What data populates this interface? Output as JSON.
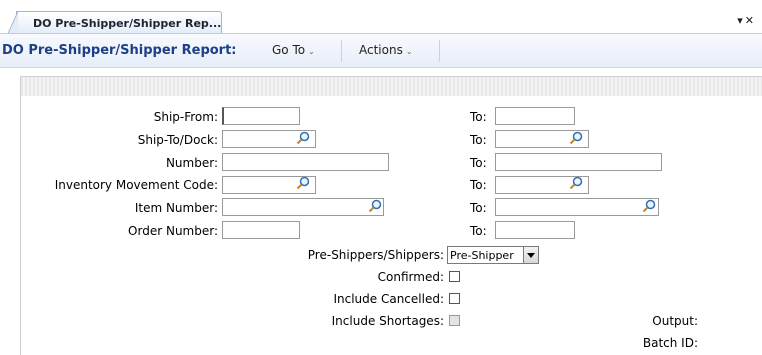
{
  "tab": {
    "label": "DO Pre-Shipper/Shipper Rep..."
  },
  "header": {
    "title": "DO Pre-Shipper/Shipper Report:",
    "goto": "Go To",
    "actions": "Actions"
  },
  "form": {
    "ship_from": "Ship-From:",
    "ship_to_dock": "Ship-To/Dock:",
    "number": "Number:",
    "inv_move_code": "Inventory Movement Code:",
    "item_number": "Item Number:",
    "order_number": "Order Number:",
    "to": "To:",
    "pre_shippers": "Pre-Shippers/Shippers:",
    "pre_shippers_value": "Pre-Shipper",
    "confirmed": "Confirmed:",
    "include_cancelled": "Include Cancelled:",
    "include_shortages": "Include Shortages:",
    "output": "Output:",
    "batch_id": "Batch ID:"
  }
}
